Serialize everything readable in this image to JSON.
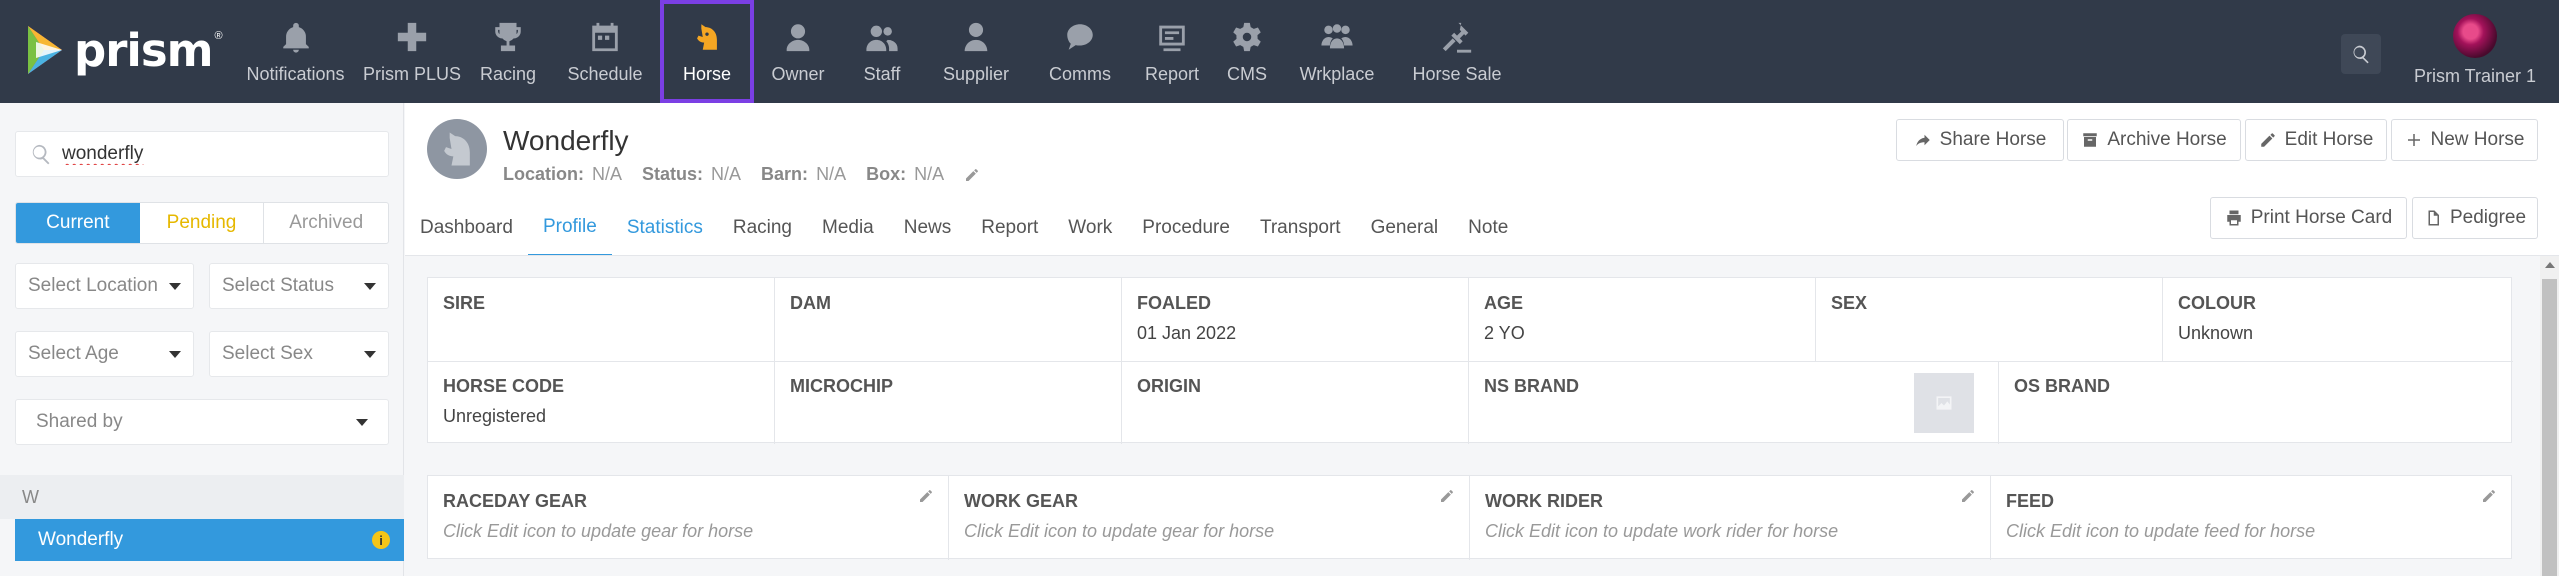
{
  "app": {
    "logo": "prism",
    "logo_mark": "®"
  },
  "nav": [
    {
      "label": "Notifications",
      "icon": "bell-icon",
      "active": false
    },
    {
      "label": "Prism PLUS",
      "icon": "plus-cross-icon",
      "active": false
    },
    {
      "label": "Racing",
      "icon": "trophy-icon",
      "active": false
    },
    {
      "label": "Schedule",
      "icon": "calendar-icon",
      "active": false
    },
    {
      "label": "Horse",
      "icon": "horse-head-icon",
      "active": true
    },
    {
      "label": "Owner",
      "icon": "person-icon",
      "active": false
    },
    {
      "label": "Staff",
      "icon": "people-icon",
      "active": false
    },
    {
      "label": "Supplier",
      "icon": "supplier-icon",
      "active": false
    },
    {
      "label": "Comms",
      "icon": "chat-icon",
      "active": false
    },
    {
      "label": "Report",
      "icon": "report-icon",
      "active": false
    },
    {
      "label": "CMS",
      "icon": "gear-icon",
      "active": false
    },
    {
      "label": "Wrkplace",
      "icon": "workplace-icon",
      "active": false
    },
    {
      "label": "Horse Sale",
      "icon": "gavel-icon",
      "active": false
    }
  ],
  "user": {
    "name": "Prism Trainer 1"
  },
  "sidebar": {
    "search_value": "wonderfly",
    "segments": [
      "Current",
      "Pending",
      "Archived"
    ],
    "filters": {
      "location": "Select Location",
      "status": "Select Status",
      "age": "Select Age",
      "sex": "Select Sex",
      "shared_by": "Shared by"
    },
    "alpha_header": "W",
    "horses": [
      "Wonderfly"
    ]
  },
  "horse": {
    "name": "Wonderfly",
    "location_label": "Location:",
    "location": "N/A",
    "status_label": "Status:",
    "status": "N/A",
    "barn_label": "Barn:",
    "barn": "N/A",
    "box_label": "Box:",
    "box": "N/A"
  },
  "actions": {
    "share": "Share Horse",
    "archive": "Archive Horse",
    "edit": "Edit Horse",
    "new": "New Horse",
    "print": "Print Horse Card",
    "pedigree": "Pedigree"
  },
  "tabs": [
    "Dashboard",
    "Profile",
    "Statistics",
    "Racing",
    "Media",
    "News",
    "Report",
    "Work",
    "Procedure",
    "Transport",
    "General",
    "Note"
  ],
  "profile": {
    "row1": [
      {
        "label": "SIRE",
        "value": ""
      },
      {
        "label": "DAM",
        "value": ""
      },
      {
        "label": "FOALED",
        "value": "01 Jan 2022"
      },
      {
        "label": "AGE",
        "value": "2 YO"
      },
      {
        "label": "SEX",
        "value": ""
      },
      {
        "label": "COLOUR",
        "value": "Unknown"
      }
    ],
    "row2": [
      {
        "label": "HORSE CODE",
        "value": "Unregistered"
      },
      {
        "label": "MICROCHIP",
        "value": ""
      },
      {
        "label": "ORIGIN",
        "value": ""
      },
      {
        "label": "NS BRAND",
        "value": ""
      },
      {
        "label": "OS BRAND",
        "value": ""
      }
    ]
  },
  "gear": [
    {
      "label": "RACEDAY GEAR",
      "hint": "Click Edit icon to update gear for horse"
    },
    {
      "label": "WORK GEAR",
      "hint": "Click Edit icon to update gear for horse"
    },
    {
      "label": "WORK RIDER",
      "hint": "Click Edit icon to update work rider for horse"
    },
    {
      "label": "FEED",
      "hint": "Click Edit icon to update feed for horse"
    }
  ],
  "colors": {
    "nav_bg": "#313a49",
    "accent": "#3399dd",
    "active_outline": "#7b3fe4",
    "pending": "#e6b800"
  }
}
